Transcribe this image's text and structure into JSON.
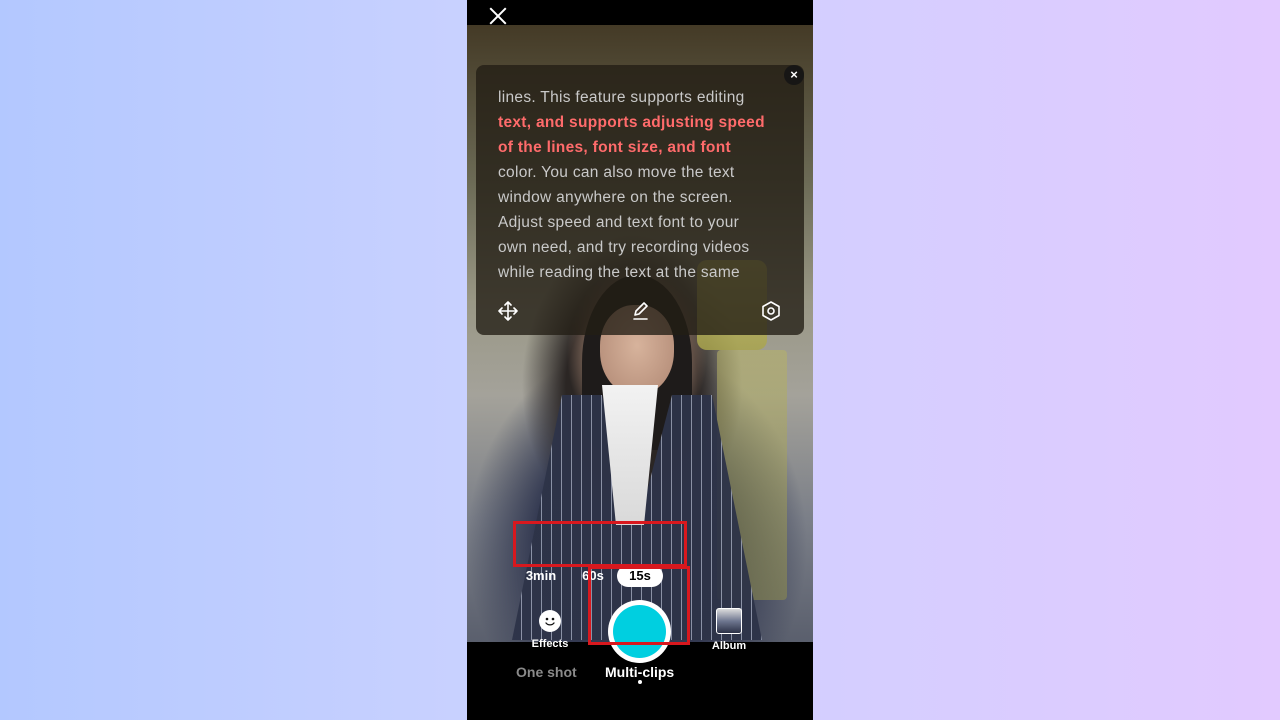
{
  "prompter": {
    "close_symbol": "×",
    "line_1": "lines. This feature supports editing",
    "line_2_highlight": "text, and supports adjusting speed",
    "line_3_highlight": "of the lines, font size, and font",
    "line_4": "color. You can also move the text",
    "line_5": "window anywhere on the screen.",
    "line_6": "Adjust speed and text font to your",
    "line_7": "own need, and try recording videos",
    "line_8": "while reading the text at the same",
    "tools": [
      "move-icon",
      "edit-icon",
      "settings-icon"
    ]
  },
  "durations": [
    "3min",
    "60s",
    "15s"
  ],
  "durations_selected": "15s",
  "effects_label": "Effects",
  "album_label": "Album",
  "modes": {
    "one_shot": "One shot",
    "multi_clips": "Multi-clips",
    "selected": "Multi-clips"
  },
  "colors": {
    "record_button": "#00cfe0",
    "highlight_text": "#ff6b6b",
    "annotation_box": "#d8181e"
  }
}
